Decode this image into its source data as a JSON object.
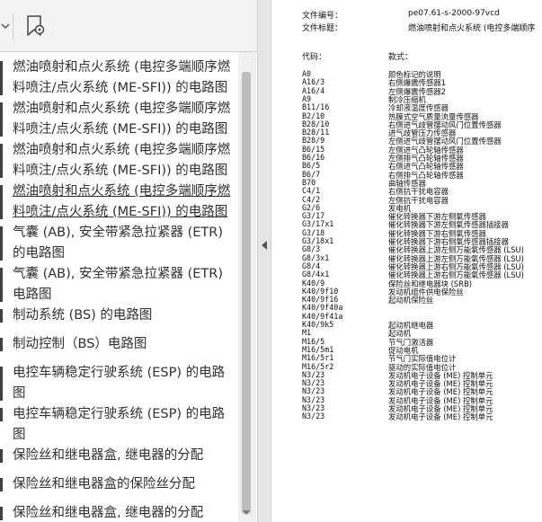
{
  "toolbar": {
    "chevron_icon": "chevron-down-icon",
    "bookmark_icon": "bookmark-settings-icon"
  },
  "bookmarks": [
    {
      "label": "燃油喷射和点火系统 (电控多端顺序燃料喷注/点火系统 (ME-SFI)) 的电路图",
      "current": false
    },
    {
      "label": "燃油喷射和点火系统 (电控多端顺序燃料喷注/点火系统 (ME-SFI)) 的电路图",
      "current": false
    },
    {
      "label": "燃油喷射和点火系统 (电控多端顺序燃料喷注/点火系统 (ME-SFI)) 的电路图",
      "current": false
    },
    {
      "label": "燃油喷射和点火系统 (电控多端顺序燃料喷注/点火系统 (ME-SFI)) 的电路图",
      "current": true
    },
    {
      "label": "气囊 (AB), 安全带紧急拉紧器 (ETR) 的电路图",
      "current": false
    },
    {
      "label": "气囊 (AB), 安全带紧急拉紧器 (ETR) 电路图",
      "current": false
    },
    {
      "label": "制动系统 (BS) 的电路图",
      "current": false
    },
    {
      "label": "制动控制（BS）电路图",
      "current": false
    },
    {
      "label": "电控车辆稳定行驶系统 (ESP) 的电路图",
      "current": false
    },
    {
      "label": "电控车辆稳定行驶系统 (ESP) 的电路图",
      "current": false
    },
    {
      "label": "保险丝和继电器盒, 继电器的分配",
      "current": false
    },
    {
      "label": "保险丝和继电器盒的保险丝分配",
      "current": false
    },
    {
      "label": "保险丝和继电器盒, 继电器的分配",
      "current": false
    }
  ],
  "document": {
    "doc_number_label": "文件编号：",
    "doc_number_value": "pe07.61-s-2000-97vcd",
    "doc_title_label": "文件标题：",
    "doc_title_value": "燃油喷射和点火系统 (电控多端顺序",
    "code_header": "代码：",
    "desc_header": "款式：",
    "legend": [
      {
        "code": "A0",
        "desc": "颜色标记的说明"
      },
      {
        "code": "A16/3",
        "desc": "右侧爆震传感器1"
      },
      {
        "code": "A16/4",
        "desc": "左侧爆震传感器2"
      },
      {
        "code": "A9",
        "desc": "制冷压缩机"
      },
      {
        "code": "B11/16",
        "desc": "冷却液温度传感器"
      },
      {
        "code": "B2/10",
        "desc": "热膜式空气质量流量传感器"
      },
      {
        "code": "B28/10",
        "desc": "右侧进气歧管摆动风门位置传感器"
      },
      {
        "code": "B28/11",
        "desc": "进气歧管压力传感器"
      },
      {
        "code": "B28/9",
        "desc": "左侧进气歧管摆动风门位置传感器"
      },
      {
        "code": "B6/15",
        "desc": "左侧进气凸轮轴传感器"
      },
      {
        "code": "B6/16",
        "desc": "左侧排气凸轮轴传感器"
      },
      {
        "code": "B6/5",
        "desc": "右侧进气凸轮轴传感器"
      },
      {
        "code": "B6/7",
        "desc": "右侧排气凸轮轴传感器"
      },
      {
        "code": "B70",
        "desc": "曲轴传感器"
      },
      {
        "code": "C4/1",
        "desc": "右侧抗干扰电容器"
      },
      {
        "code": "C4/2",
        "desc": "左侧抗干扰电容器"
      },
      {
        "code": "G2/6",
        "desc": "发电机"
      },
      {
        "code": "G3/17",
        "desc": "催化转换器下游左侧氧传感器"
      },
      {
        "code": "G3/17x1",
        "desc": "催化转换器下游左侧氧传感器插接器"
      },
      {
        "code": "G3/18",
        "desc": "催化转换器下游右侧氧传感器"
      },
      {
        "code": "G3/18x1",
        "desc": "催化转换器下游右侧氧传感器插接器"
      },
      {
        "code": "G8/3",
        "desc": "催化转换器上游左侧万能氧传感器 (LSU)"
      },
      {
        "code": "G8/3x1",
        "desc": "催化转换器上游左侧万能氧传感器 (LSU)"
      },
      {
        "code": "G8/4",
        "desc": "催化转换器上游右侧万能氧传感器 (LSU)"
      },
      {
        "code": "G8/4x1",
        "desc": "催化转换器上游右侧万能氧传感器 (LSU)"
      },
      {
        "code": "K40/9",
        "desc": "保险丝和继电器块 (SRB)"
      },
      {
        "code": "K40/9f10",
        "desc": "发动机组件供电保险丝"
      },
      {
        "code": "K40/9f16",
        "desc": "起动机保险丝"
      },
      {
        "code": "K40/9f40a",
        "desc": ""
      },
      {
        "code": "K40/9f41a",
        "desc": ""
      },
      {
        "code": "K40/9k5",
        "desc": "起动机继电器"
      },
      {
        "code": "M1",
        "desc": "起动机"
      },
      {
        "code": "M16/5",
        "desc": "节气门激活器"
      },
      {
        "code": "M16/5m1",
        "desc": "促动电机"
      },
      {
        "code": "M16/5r1",
        "desc": "节气门实际值电位计"
      },
      {
        "code": "M16/5r2",
        "desc": "驱动的实际值电位计"
      },
      {
        "code": "N3/23",
        "desc": "发动机电子设备 (ME) 控制单元"
      },
      {
        "code": "N3/23",
        "desc": "发动机电子设备 (ME) 控制单元"
      },
      {
        "code": "N3/23",
        "desc": "发动机电子设备 (ME) 控制单元"
      },
      {
        "code": "N3/23",
        "desc": "发动机电子设备 (ME) 控制单元"
      },
      {
        "code": "N3/23",
        "desc": "发动机电子设备 (ME) 控制单元"
      },
      {
        "code": "N3/23",
        "desc": "发动机电子设备 (ME) 控制单元"
      }
    ]
  }
}
